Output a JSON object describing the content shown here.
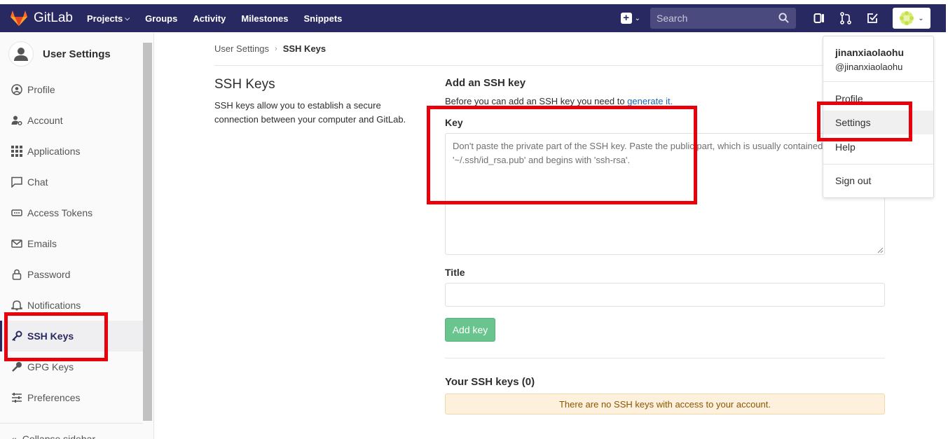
{
  "navbar": {
    "brand": "GitLab",
    "links": [
      "Projects",
      "Groups",
      "Activity",
      "Milestones",
      "Snippets"
    ],
    "search_placeholder": "Search"
  },
  "sidebar": {
    "title": "User Settings",
    "items": [
      {
        "label": "Profile",
        "icon": "profile-icon"
      },
      {
        "label": "Account",
        "icon": "account-icon"
      },
      {
        "label": "Applications",
        "icon": "applications-icon"
      },
      {
        "label": "Chat",
        "icon": "chat-icon"
      },
      {
        "label": "Access Tokens",
        "icon": "access-tokens-icon"
      },
      {
        "label": "Emails",
        "icon": "emails-icon"
      },
      {
        "label": "Password",
        "icon": "lock-icon"
      },
      {
        "label": "Notifications",
        "icon": "bell-icon"
      },
      {
        "label": "SSH Keys",
        "icon": "key-icon",
        "active": true
      },
      {
        "label": "GPG Keys",
        "icon": "key-icon"
      },
      {
        "label": "Preferences",
        "icon": "preferences-icon"
      }
    ],
    "collapse_label": "Collapse sidebar"
  },
  "breadcrumb": {
    "root": "User Settings",
    "current": "SSH Keys"
  },
  "intro": {
    "title": "SSH Keys",
    "description": "SSH keys allow you to establish a secure connection between your computer and GitLab."
  },
  "form": {
    "heading": "Add an SSH key",
    "help_prefix": "Before you can add an SSH key you need to ",
    "help_link": "generate it.",
    "key_label": "Key",
    "key_placeholder": "Don't paste the private part of the SSH key. Paste the public part, which is usually contained in the file '~/.ssh/id_rsa.pub' and begins with 'ssh-rsa'.",
    "title_label": "Title",
    "title_value": "",
    "submit_label": "Add key"
  },
  "keys_list": {
    "heading": "Your SSH keys (0)",
    "empty_message": "There are no SSH keys with access to your account."
  },
  "user_menu": {
    "name": "jinanxiaolaohu",
    "handle": "@jinanxiaolaohu",
    "items": [
      "Profile",
      "Settings",
      "Help",
      "Sign out"
    ]
  },
  "colors": {
    "navbar": "#292961",
    "annotation": "#e8000b",
    "button": "#69c48e",
    "link": "#1b69b6",
    "warning_bg": "#fdf1dd"
  }
}
